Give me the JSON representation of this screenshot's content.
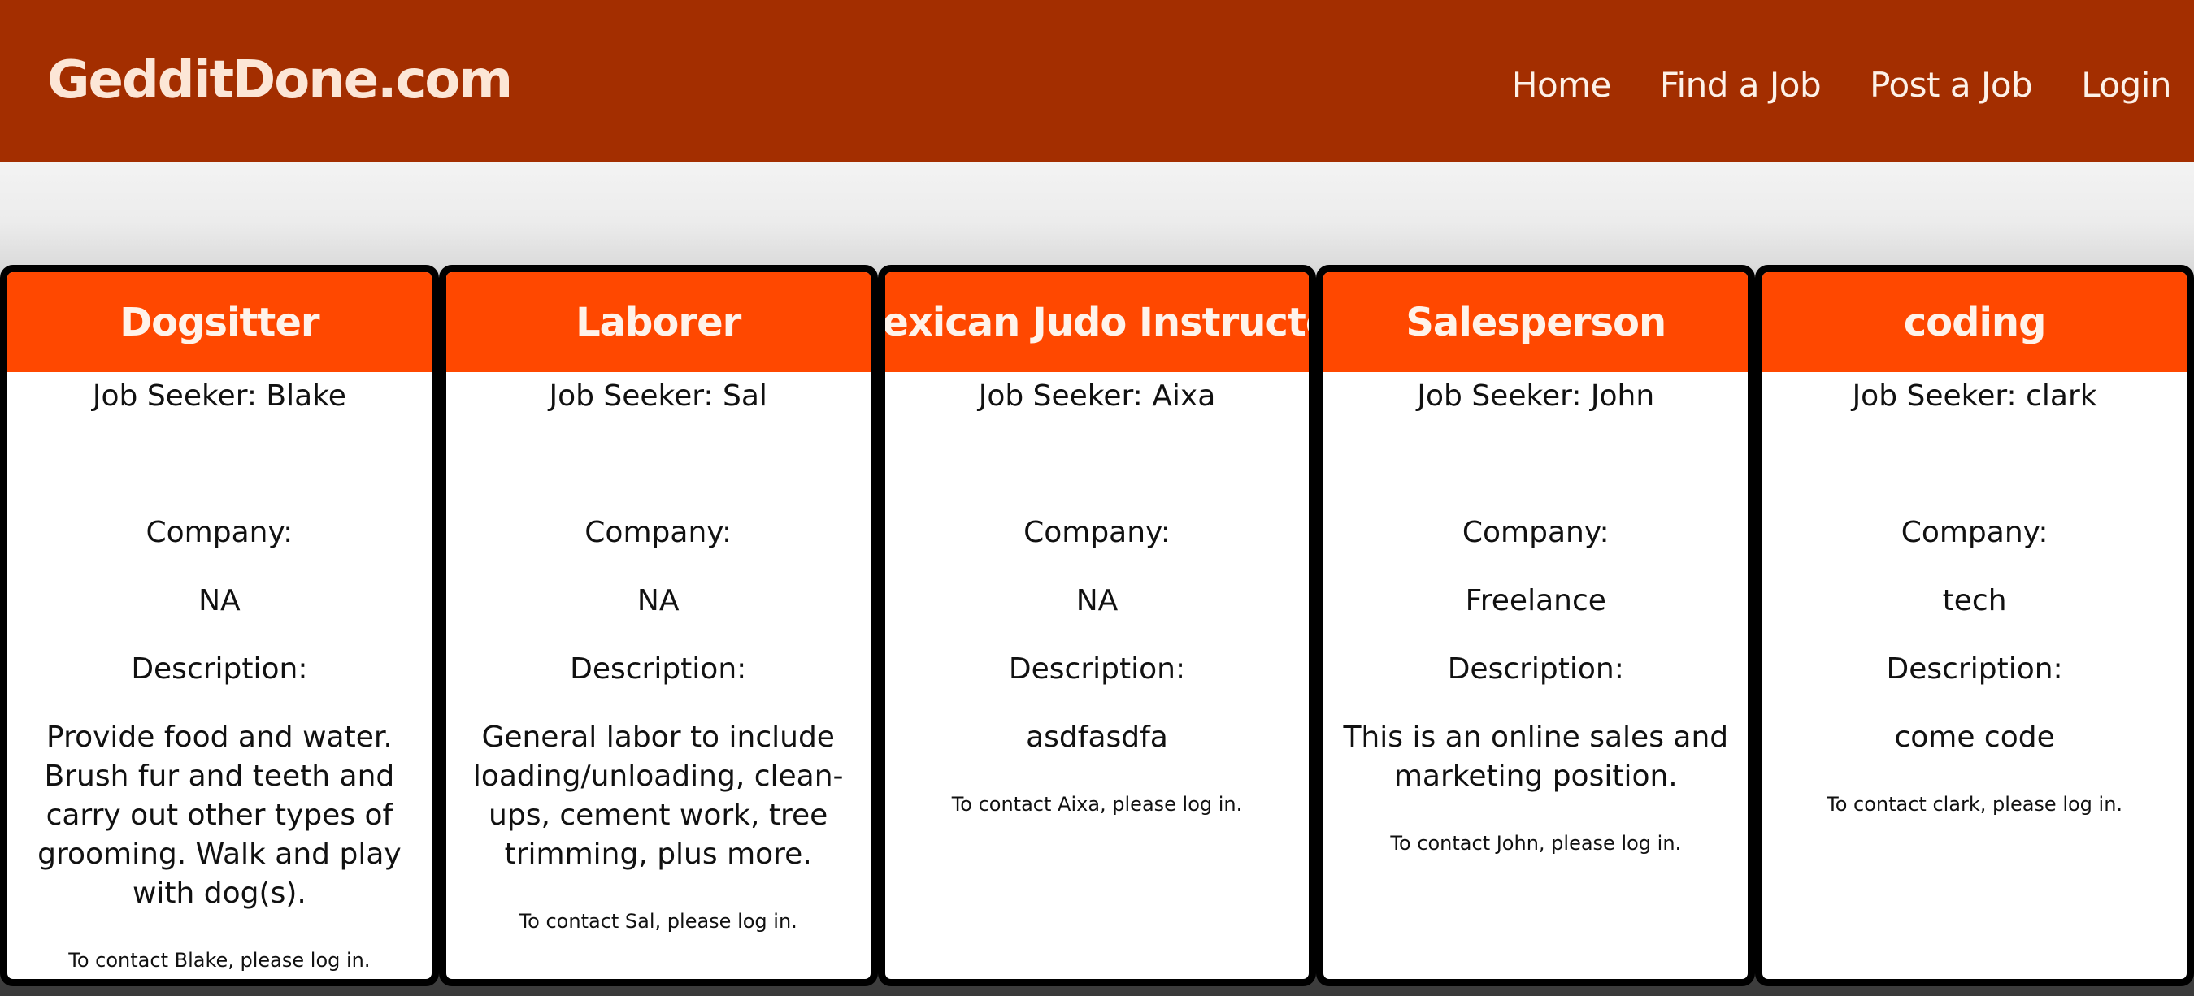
{
  "site": {
    "brand": "GedditDone.com",
    "nav": {
      "home": "Home",
      "find_job": "Find a Job",
      "post_job": "Post a Job",
      "login": "Login"
    }
  },
  "labels": {
    "company": "Company:",
    "description": "Description:"
  },
  "jobs": [
    {
      "title": "Dogsitter",
      "seeker": "Job Seeker: Blake",
      "company": "NA",
      "description": "Provide food and water. Brush fur and teeth and carry out other types of grooming. Walk and play with dog(s).",
      "contact": "To contact Blake, please log in."
    },
    {
      "title": "Laborer",
      "seeker": "Job Seeker: Sal",
      "company": "NA",
      "description": "General labor to include loading/unloading, clean-ups, cement work, tree trimming, plus more.",
      "contact": "To contact Sal, please log in."
    },
    {
      "title": "Mexican Judo Instructor",
      "seeker": "Job Seeker: Aixa",
      "company": "NA",
      "description": "asdfasdfa",
      "contact": "To contact Aixa, please log in."
    },
    {
      "title": "Salesperson",
      "seeker": "Job Seeker: John",
      "company": "Freelance",
      "description": "This is an online sales and marketing position.",
      "contact": "To contact John, please log in."
    },
    {
      "title": "coding",
      "seeker": "Job Seeker: clark",
      "company": "tech",
      "description": "come code",
      "contact": "To contact clark, please log in."
    }
  ],
  "colors": {
    "navbar": "#a32e00",
    "card_header": "#ff4800",
    "card_border": "#000000"
  }
}
